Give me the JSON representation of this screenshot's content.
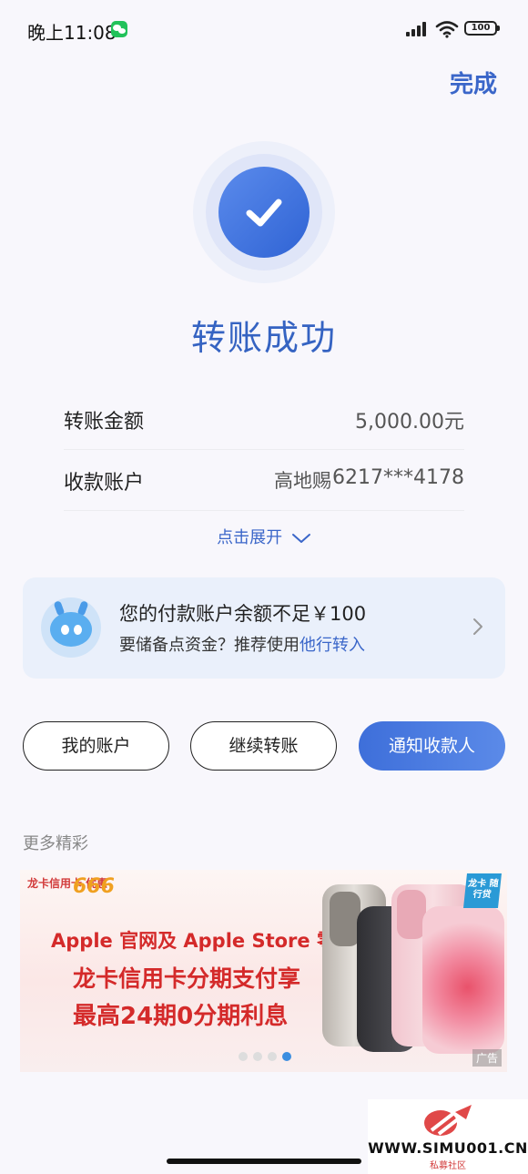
{
  "status_bar": {
    "time": "晚上11:08",
    "battery": "100",
    "icons": [
      "wechat-icon",
      "signal-icon",
      "wifi-icon",
      "battery-icon"
    ]
  },
  "header": {
    "done_label": "完成"
  },
  "result": {
    "icon": "check-icon",
    "title": "转账成功",
    "accent": "#3563c2"
  },
  "details": {
    "amount_label": "转账金额",
    "amount_value": "5,000.00元",
    "payee_label": "收款账户",
    "payee_name": "高地赐",
    "payee_account": "6217***4178",
    "expand_label": "点击展开"
  },
  "notice": {
    "line1": "您的付款账户余额不足￥100",
    "line2_prefix": "要储备点资金？推荐使用",
    "line2_link": "他行转入"
  },
  "actions": {
    "my_account": "我的账户",
    "continue_transfer": "继续转账",
    "notify_payee": "通知收款人"
  },
  "more_section": {
    "title": "更多精彩"
  },
  "banner": {
    "brand": "龙卡信用卡 优惠",
    "promo_number": "666",
    "line1": "Apple 官网及 Apple Store 零售店",
    "line2": "龙卡信用卡分期支付享",
    "line3": "最高24期0分期利息",
    "tag": "龙卡 随行贷",
    "ad_label": "广告",
    "slides": 4,
    "active_slide": 4
  },
  "watermark": {
    "url": "WWW.SIMU001.CN",
    "sub": "私募社区"
  },
  "colors": {
    "primary": "#3a66c9",
    "background": "#f8f7fc",
    "notice_bg": "#eaf0fb"
  }
}
